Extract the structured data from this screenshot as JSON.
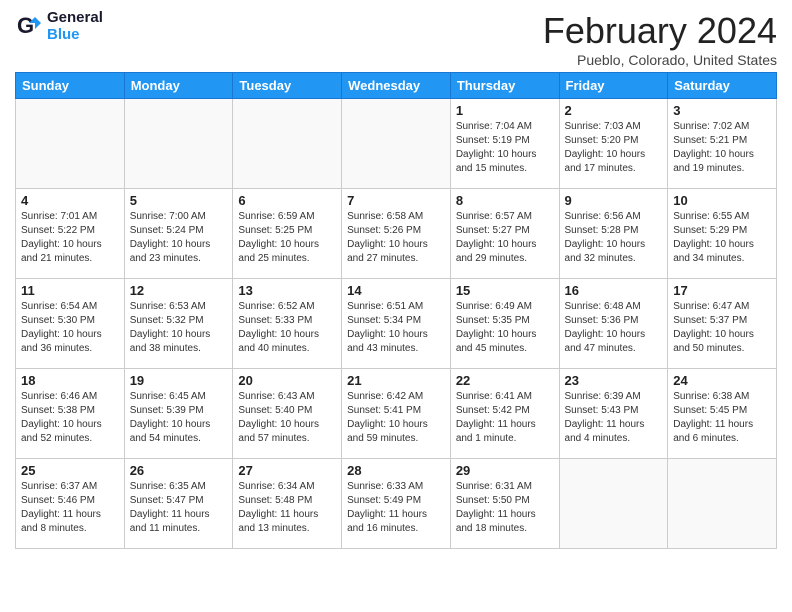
{
  "logo": {
    "line1": "General",
    "line2": "Blue"
  },
  "title": "February 2024",
  "subtitle": "Pueblo, Colorado, United States",
  "headers": [
    "Sunday",
    "Monday",
    "Tuesday",
    "Wednesday",
    "Thursday",
    "Friday",
    "Saturday"
  ],
  "weeks": [
    [
      {
        "day": "",
        "info": ""
      },
      {
        "day": "",
        "info": ""
      },
      {
        "day": "",
        "info": ""
      },
      {
        "day": "",
        "info": ""
      },
      {
        "day": "1",
        "info": "Sunrise: 7:04 AM\nSunset: 5:19 PM\nDaylight: 10 hours\nand 15 minutes."
      },
      {
        "day": "2",
        "info": "Sunrise: 7:03 AM\nSunset: 5:20 PM\nDaylight: 10 hours\nand 17 minutes."
      },
      {
        "day": "3",
        "info": "Sunrise: 7:02 AM\nSunset: 5:21 PM\nDaylight: 10 hours\nand 19 minutes."
      }
    ],
    [
      {
        "day": "4",
        "info": "Sunrise: 7:01 AM\nSunset: 5:22 PM\nDaylight: 10 hours\nand 21 minutes."
      },
      {
        "day": "5",
        "info": "Sunrise: 7:00 AM\nSunset: 5:24 PM\nDaylight: 10 hours\nand 23 minutes."
      },
      {
        "day": "6",
        "info": "Sunrise: 6:59 AM\nSunset: 5:25 PM\nDaylight: 10 hours\nand 25 minutes."
      },
      {
        "day": "7",
        "info": "Sunrise: 6:58 AM\nSunset: 5:26 PM\nDaylight: 10 hours\nand 27 minutes."
      },
      {
        "day": "8",
        "info": "Sunrise: 6:57 AM\nSunset: 5:27 PM\nDaylight: 10 hours\nand 29 minutes."
      },
      {
        "day": "9",
        "info": "Sunrise: 6:56 AM\nSunset: 5:28 PM\nDaylight: 10 hours\nand 32 minutes."
      },
      {
        "day": "10",
        "info": "Sunrise: 6:55 AM\nSunset: 5:29 PM\nDaylight: 10 hours\nand 34 minutes."
      }
    ],
    [
      {
        "day": "11",
        "info": "Sunrise: 6:54 AM\nSunset: 5:30 PM\nDaylight: 10 hours\nand 36 minutes."
      },
      {
        "day": "12",
        "info": "Sunrise: 6:53 AM\nSunset: 5:32 PM\nDaylight: 10 hours\nand 38 minutes."
      },
      {
        "day": "13",
        "info": "Sunrise: 6:52 AM\nSunset: 5:33 PM\nDaylight: 10 hours\nand 40 minutes."
      },
      {
        "day": "14",
        "info": "Sunrise: 6:51 AM\nSunset: 5:34 PM\nDaylight: 10 hours\nand 43 minutes."
      },
      {
        "day": "15",
        "info": "Sunrise: 6:49 AM\nSunset: 5:35 PM\nDaylight: 10 hours\nand 45 minutes."
      },
      {
        "day": "16",
        "info": "Sunrise: 6:48 AM\nSunset: 5:36 PM\nDaylight: 10 hours\nand 47 minutes."
      },
      {
        "day": "17",
        "info": "Sunrise: 6:47 AM\nSunset: 5:37 PM\nDaylight: 10 hours\nand 50 minutes."
      }
    ],
    [
      {
        "day": "18",
        "info": "Sunrise: 6:46 AM\nSunset: 5:38 PM\nDaylight: 10 hours\nand 52 minutes."
      },
      {
        "day": "19",
        "info": "Sunrise: 6:45 AM\nSunset: 5:39 PM\nDaylight: 10 hours\nand 54 minutes."
      },
      {
        "day": "20",
        "info": "Sunrise: 6:43 AM\nSunset: 5:40 PM\nDaylight: 10 hours\nand 57 minutes."
      },
      {
        "day": "21",
        "info": "Sunrise: 6:42 AM\nSunset: 5:41 PM\nDaylight: 10 hours\nand 59 minutes."
      },
      {
        "day": "22",
        "info": "Sunrise: 6:41 AM\nSunset: 5:42 PM\nDaylight: 11 hours\nand 1 minute."
      },
      {
        "day": "23",
        "info": "Sunrise: 6:39 AM\nSunset: 5:43 PM\nDaylight: 11 hours\nand 4 minutes."
      },
      {
        "day": "24",
        "info": "Sunrise: 6:38 AM\nSunset: 5:45 PM\nDaylight: 11 hours\nand 6 minutes."
      }
    ],
    [
      {
        "day": "25",
        "info": "Sunrise: 6:37 AM\nSunset: 5:46 PM\nDaylight: 11 hours\nand 8 minutes."
      },
      {
        "day": "26",
        "info": "Sunrise: 6:35 AM\nSunset: 5:47 PM\nDaylight: 11 hours\nand 11 minutes."
      },
      {
        "day": "27",
        "info": "Sunrise: 6:34 AM\nSunset: 5:48 PM\nDaylight: 11 hours\nand 13 minutes."
      },
      {
        "day": "28",
        "info": "Sunrise: 6:33 AM\nSunset: 5:49 PM\nDaylight: 11 hours\nand 16 minutes."
      },
      {
        "day": "29",
        "info": "Sunrise: 6:31 AM\nSunset: 5:50 PM\nDaylight: 11 hours\nand 18 minutes."
      },
      {
        "day": "",
        "info": ""
      },
      {
        "day": "",
        "info": ""
      }
    ]
  ]
}
